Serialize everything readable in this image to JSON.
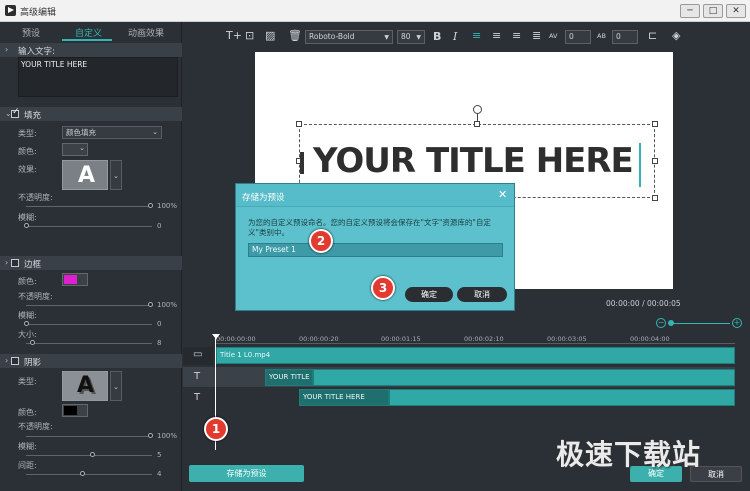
{
  "window": {
    "title": "高级编辑",
    "controls": [
      "─",
      "□",
      "✕"
    ]
  },
  "left_panel": {
    "tabs": [
      {
        "label": "预设",
        "active": false
      },
      {
        "label": "自定义",
        "active": true
      },
      {
        "label": "动画效果",
        "active": false
      }
    ],
    "input_text": {
      "header": "输入文字:",
      "value": "YOUR TITLE HERE"
    },
    "fill": {
      "header": "填充",
      "checked": true,
      "type_label": "类型:",
      "type_value": "颜色填充",
      "color_label": "颜色:",
      "effect_label": "效果:",
      "effect_glyph": "A",
      "opacity_label": "不透明度:",
      "opacity_value": "100%",
      "blur_label": "模糊:",
      "blur_value": "0"
    },
    "border": {
      "header": "边框",
      "checked": false,
      "color_label": "颜色:",
      "color": "#e020d0",
      "opacity_label": "不透明度:",
      "opacity_value": "100%",
      "blur_label": "模糊:",
      "blur_value": "0",
      "size_label": "大小:",
      "size_value": "8"
    },
    "shadow": {
      "header": "阴影",
      "checked": false,
      "type_label": "类型:",
      "type_glyph": "A",
      "color_label": "颜色:",
      "color": "#000000",
      "opacity_label": "不透明度:",
      "opacity_value": "100%",
      "blur_label": "模糊:",
      "blur_value": "5",
      "distance_label": "间距:",
      "distance_value": "4"
    },
    "save_preset_button": "存储为预设"
  },
  "toolbar": {
    "font": "Roboto-Bold",
    "size": "80",
    "bold": "B",
    "italic": "I",
    "char_spacing": "0",
    "line_spacing": "0",
    "char_spacing_icon": "AV",
    "line_spacing_icon": "AB"
  },
  "preview": {
    "title_text": "YOUR TITLE HERE",
    "timecode": "00:00:00 / 00:00:05"
  },
  "timeline": {
    "ruler": [
      "00:00:00:00",
      "00:00:00:20",
      "00:00:01:15",
      "00:00:02:10",
      "00:00:03:05",
      "00:00:04:00"
    ],
    "clips": [
      {
        "label": "Title 1 L0.mp4"
      },
      {
        "label": "YOUR TITLE HERE"
      },
      {
        "label": "YOUR TITLE HERE"
      }
    ],
    "track_icons": [
      "▭",
      "T",
      "T"
    ]
  },
  "dialog": {
    "title": "存储为预设",
    "message": "为您的自定义预设命名。您的自定义预设将会保存在\"文字\"资源库的\"自定义\"类别中。",
    "input_value": "My Preset 1",
    "ok_label": "确定",
    "cancel_label": "取消",
    "close": "✕"
  },
  "steps": [
    "1",
    "2",
    "3"
  ],
  "bottom": {
    "ok_label": "确定",
    "cancel_label": "取消"
  },
  "watermark": "极速下载站"
}
